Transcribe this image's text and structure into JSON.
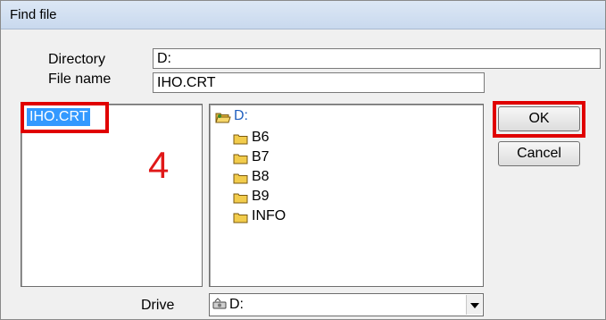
{
  "window": {
    "title": "Find file"
  },
  "form": {
    "directory_label": "Directory",
    "directory_value": "D:",
    "filename_label": "File name",
    "filename_value": "IHO.CRT",
    "drive_label": "Drive",
    "drive_value": "D:"
  },
  "file_list": {
    "items": [
      "IHO.CRT"
    ],
    "selected": "IHO.CRT"
  },
  "dir_tree": {
    "root": "D:",
    "folders": [
      "B6",
      "B7",
      "B8",
      "B9",
      "INFO"
    ]
  },
  "buttons": {
    "ok": "OK",
    "cancel": "Cancel"
  },
  "annotation": {
    "step": "4"
  },
  "colors": {
    "highlight": "#e00000",
    "selection": "#3399ff",
    "folder": "#f2cc4c",
    "title_bar": "#dce7f5"
  },
  "icons": {
    "folder": "folder-icon",
    "open_folder": "folder-open-icon",
    "drive": "drive-icon",
    "dropdown": "chevron-down-icon"
  }
}
